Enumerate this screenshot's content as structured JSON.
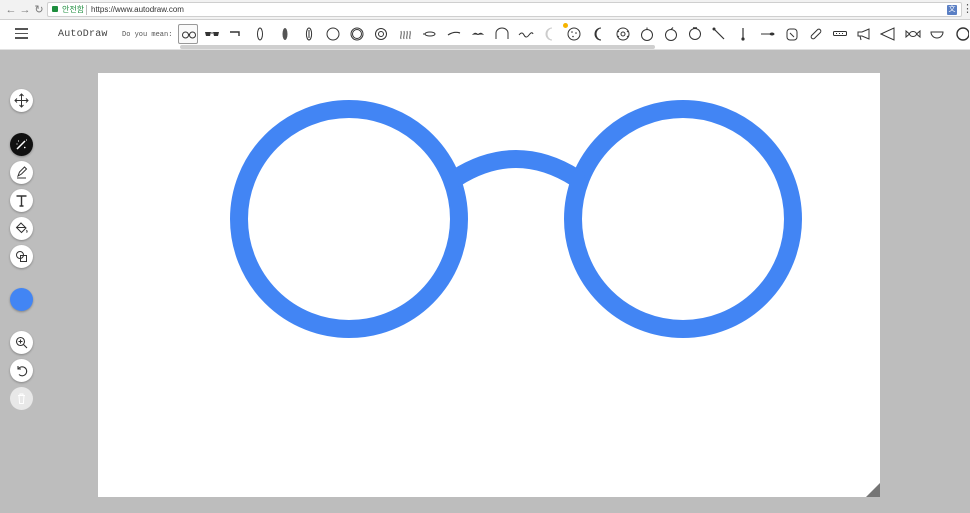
{
  "browser": {
    "back_icon": "arrow-left-icon",
    "forward_icon": "arrow-right-icon",
    "reload_icon": "reload-icon",
    "secure_label": "안전함",
    "url": "https://www.autodraw.com",
    "translate_icon": "translate-icon",
    "menu_icon": "more-vert-icon"
  },
  "header": {
    "menu_icon": "hamburger-menu-icon",
    "app_name": "AutoDraw",
    "suggestions_label": "Do you mean:",
    "suggestions": [
      "glasses-round",
      "glasses-sunglasses",
      "glasses-pipe",
      "bracket-oval",
      "peanut",
      "bean",
      "circle",
      "ring-double",
      "target-circle",
      "steam-lines",
      "fish",
      "whistle",
      "mustache",
      "arch-bridge",
      "wave-line",
      "moon-faint",
      "cookie",
      "crescent-moon",
      "donut",
      "orange",
      "apple",
      "light-bulb",
      "matchstick",
      "key",
      "lollipop",
      "bread",
      "bandage",
      "harmonica",
      "megaphone",
      "triangle-flag",
      "candy",
      "bowl",
      "circle-edge"
    ]
  },
  "tools": [
    {
      "name": "select-move-tool",
      "icon": "move-arrows-icon"
    },
    {
      "name": "autodraw-tool",
      "icon": "autodraw-wand-icon",
      "active": true
    },
    {
      "name": "draw-tool",
      "icon": "pencil-icon"
    },
    {
      "name": "type-tool",
      "icon": "text-t-icon"
    },
    {
      "name": "fill-tool",
      "icon": "paint-bucket-icon"
    },
    {
      "name": "shape-tool",
      "icon": "shapes-icon"
    },
    {
      "name": "zoom-tool",
      "icon": "zoom-in-icon"
    },
    {
      "name": "undo-tool",
      "icon": "undo-icon"
    },
    {
      "name": "delete-tool",
      "icon": "trash-icon",
      "disabled": true
    }
  ],
  "colors": {
    "current": "#4285f4",
    "stroke": "#4285f4",
    "canvas_bg": "#ffffff",
    "workspace_bg": "#bdbdbd"
  },
  "canvas": {
    "drawing": "round glasses"
  }
}
